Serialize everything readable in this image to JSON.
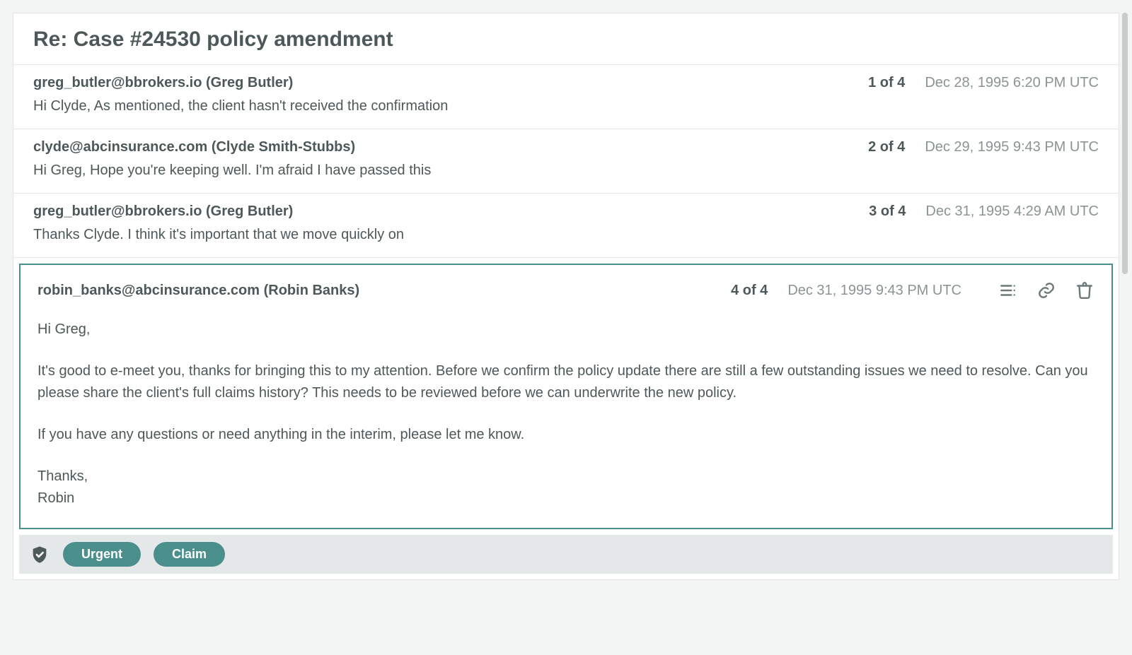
{
  "thread": {
    "subject": "Re: Case #24530 policy amendment",
    "messages": [
      {
        "from": "greg_butler@bbrokers.io (Greg Butler)",
        "count": "1 of 4",
        "date": "Dec 28, 1995 6:20 PM UTC",
        "snippet": "Hi Clyde, As mentioned, the client hasn't received the confirmation"
      },
      {
        "from": "clyde@abcinsurance.com (Clyde Smith-Stubbs)",
        "count": "2 of 4",
        "date": "Dec 29, 1995 9:43 PM UTC",
        "snippet": "Hi Greg, Hope you're keeping well. I'm afraid I have passed this"
      },
      {
        "from": "greg_butler@bbrokers.io (Greg Butler)",
        "count": "3 of 4",
        "date": "Dec 31, 1995 4:29 AM UTC",
        "snippet": "Thanks Clyde. I think it's important that we move quickly on"
      }
    ],
    "expanded": {
      "from": "robin_banks@abcinsurance.com (Robin Banks)",
      "count": "4 of 4",
      "date": "Dec 31, 1995 9:43 PM UTC",
      "body": {
        "greeting": "Hi Greg,",
        "p1": "It's good to e-meet you, thanks for bringing this to my attention. Before we confirm the policy update there are still a few outstanding issues we need to resolve. Can you please share the client's full claims history? This needs to be reviewed before we can underwrite the new policy.",
        "p2": "If you have any questions or need anything in the interim, please let me know.",
        "signoff": "Thanks,",
        "name": "Robin"
      }
    },
    "tags": {
      "urgent": "Urgent",
      "claim": "Claim"
    }
  }
}
